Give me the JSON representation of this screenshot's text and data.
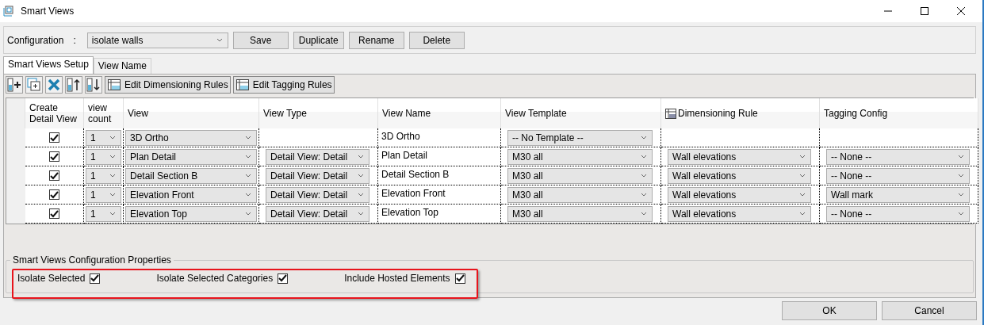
{
  "window": {
    "title": "Smart Views"
  },
  "configuration": {
    "label": "Configuration",
    "separator": ":",
    "value": "isolate walls",
    "buttons": [
      "Save",
      "Duplicate",
      "Rename",
      "Delete"
    ]
  },
  "tabs": [
    {
      "label": "Smart Views Setup",
      "selected": true
    },
    {
      "label": "View Name",
      "selected": false
    }
  ],
  "toolbar": {
    "icon_buttons": [
      {
        "kind": "add-row"
      },
      {
        "kind": "copy"
      },
      {
        "kind": "delete"
      },
      {
        "kind": "move-up"
      },
      {
        "kind": "move-down"
      }
    ],
    "buttons": [
      "Edit Dimensioning Rules",
      "Edit Tagging Rules"
    ]
  },
  "table": {
    "columns": [
      "Create Detail View",
      "view count",
      "View",
      "View Type",
      "View Name",
      "View Template",
      "Dimensioning Rule",
      "Tagging Config"
    ],
    "rows": [
      {
        "create": true,
        "count": "1",
        "view": "3D Ortho",
        "view_name": "3D Ortho",
        "template": "-- No Template --"
      },
      {
        "create": true,
        "count": "1",
        "view": "Plan Detail",
        "view_type": "Detail View: Detail",
        "view_name": "Plan Detail",
        "template": "M30 all",
        "dimensioning": "Wall elevations",
        "tagging": "-- None --"
      },
      {
        "create": true,
        "count": "1",
        "view": "Detail Section B",
        "view_type": "Detail View: Detail",
        "view_name": "Detail Section B",
        "template": "M30 all",
        "dimensioning": "Wall elevations",
        "tagging": "-- None --"
      },
      {
        "create": true,
        "count": "1",
        "view": "Elevation Front",
        "view_type": "Detail View: Detail",
        "view_name": "Elevation Front",
        "template": "M30 all",
        "dimensioning": "Wall elevations",
        "tagging": "Wall mark"
      },
      {
        "create": true,
        "count": "1",
        "view": "Elevation Top",
        "view_type": "Detail View: Detail",
        "view_name": "Elevation Top",
        "template": "M30 all",
        "dimensioning": "Wall elevations",
        "tagging": "-- None --"
      }
    ]
  },
  "properties": {
    "title": "Smart Views Configuration Properties",
    "highlighted": true,
    "options": [
      {
        "label": "Isolate Selected",
        "checked": true
      },
      {
        "label": "Isolate Selected Categories",
        "checked": true
      },
      {
        "label": "Include Hosted Elements",
        "checked": true
      }
    ]
  },
  "buttons": [
    "OK",
    "Cancel"
  ]
}
